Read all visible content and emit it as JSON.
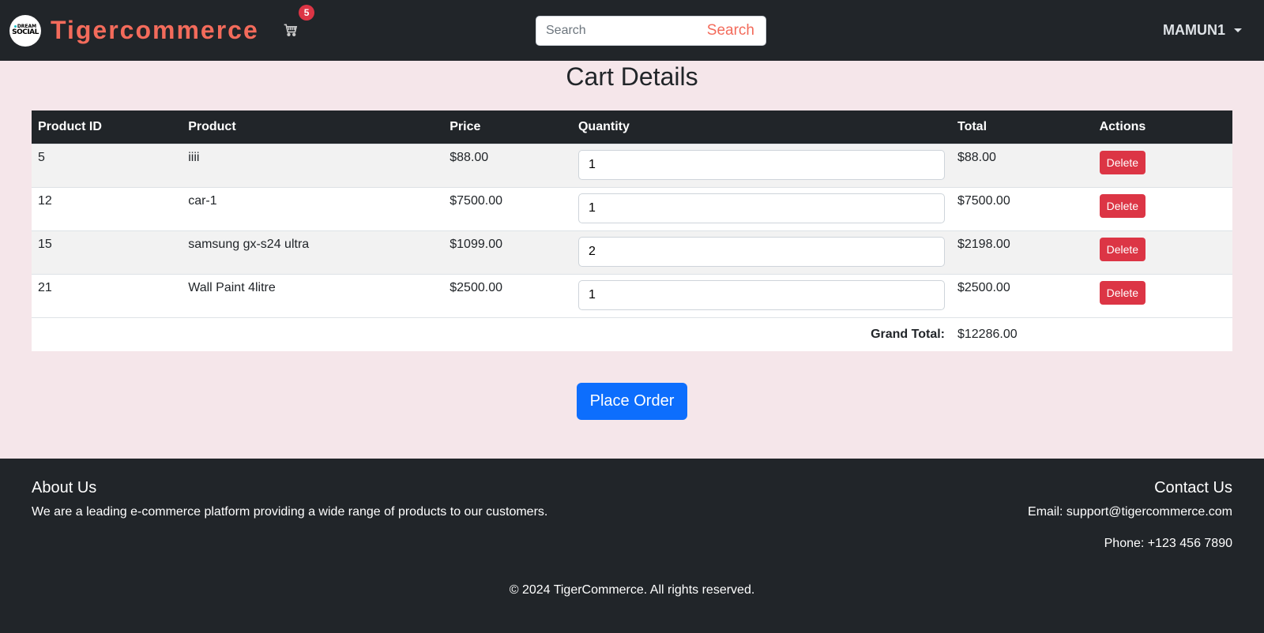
{
  "nav": {
    "logo_line1": "DREAM",
    "logo_line2": "SOCIAL",
    "brand": "Tigercommerce",
    "cart_count": "5",
    "search_placeholder": "Search",
    "search_button": "Search",
    "user": "MAMUN1"
  },
  "page_title": "Cart Details",
  "table": {
    "headers": [
      "Product ID",
      "Product",
      "Price",
      "Quantity",
      "Total",
      "Actions"
    ],
    "rows": [
      {
        "id": "5",
        "product": "iiii",
        "price": "$88.00",
        "quantity": "1",
        "total": "$88.00",
        "action": "Delete"
      },
      {
        "id": "12",
        "product": "car-1",
        "price": "$7500.00",
        "quantity": "1",
        "total": "$7500.00",
        "action": "Delete"
      },
      {
        "id": "15",
        "product": "samsung gx-s24 ultra",
        "price": "$1099.00",
        "quantity": "2",
        "total": "$2198.00",
        "action": "Delete"
      },
      {
        "id": "21",
        "product": "Wall Paint 4litre",
        "price": "$2500.00",
        "quantity": "1",
        "total": "$2500.00",
        "action": "Delete"
      }
    ],
    "grand_total_label": "Grand Total:",
    "grand_total_value": "$12286.00"
  },
  "place_order": "Place Order",
  "footer": {
    "about_title": "About Us",
    "about_text": "We are a leading e-commerce platform providing a wide range of products to our customers.",
    "contact_title": "Contact Us",
    "email": "Email: support@tigercommerce.com",
    "phone": "Phone: +123 456 7890",
    "copyright": "© 2024 TigerCommerce. All rights reserved."
  },
  "colors": {
    "navbar_bg": "#212529",
    "brand": "#f36b5b",
    "danger": "#dc3545",
    "primary": "#0d6efd",
    "page_bg": "#f5e6ea"
  }
}
